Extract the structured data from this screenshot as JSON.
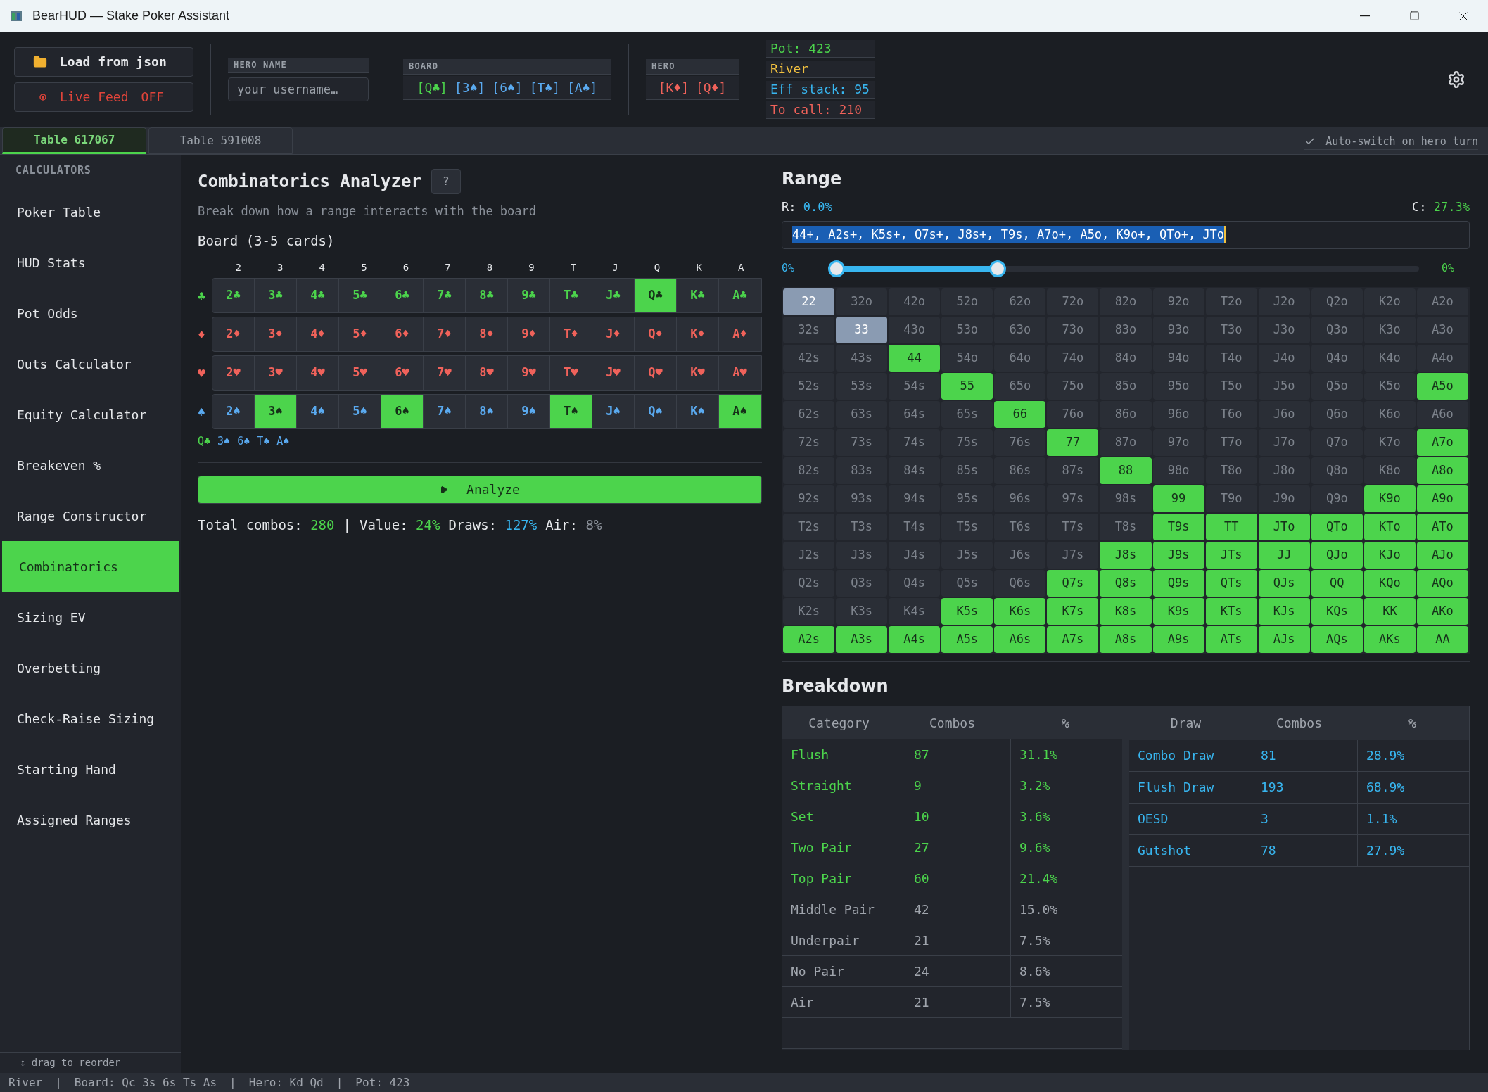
{
  "window": {
    "title": "BearHUD — Stake Poker Assistant"
  },
  "toolbar": {
    "load_button": "Load from json",
    "live_feed": {
      "label": "Live Feed",
      "state": "OFF",
      "on": false
    },
    "hero_name": {
      "label": "HERO NAME",
      "placeholder": "your username…"
    },
    "board": {
      "label": "BOARD",
      "cards": [
        {
          "label": "[Q♣]",
          "color": "#4cd44c"
        },
        {
          "label": "[3♠]",
          "color": "#5aaaf0"
        },
        {
          "label": "[6♠]",
          "color": "#5aaaf0"
        },
        {
          "label": "[T♠]",
          "color": "#5aaaf0"
        },
        {
          "label": "[A♠]",
          "color": "#5aaaf0"
        }
      ]
    },
    "hero": {
      "label": "HERO",
      "cards": [
        {
          "label": "[K♦]",
          "color": "#f0625a"
        },
        {
          "label": "[Q♦]",
          "color": "#f0625a"
        }
      ]
    },
    "stats": [
      {
        "label": "Pot: 423",
        "color": "#4cd44c"
      },
      {
        "label": "River",
        "color": "#f0c040"
      },
      {
        "label": "Eff stack: 95",
        "color": "#38b6f0"
      },
      {
        "label": "To call: 210",
        "color": "#f0625a"
      }
    ]
  },
  "tabs": [
    {
      "label": "Table 617067",
      "selected": true
    },
    {
      "label": "Table 591008",
      "selected": false
    }
  ],
  "auto_switch": {
    "label": "Auto-switch on hero turn",
    "checked": true
  },
  "sidebar": {
    "heading": "CALCULATORS",
    "items": [
      {
        "label": "Poker Table",
        "selected": false
      },
      {
        "label": "HUD Stats",
        "selected": false
      },
      {
        "label": "Pot Odds",
        "selected": false
      },
      {
        "label": "Outs Calculator",
        "selected": false
      },
      {
        "label": "Equity Calculator",
        "selected": false
      },
      {
        "label": "Breakeven %",
        "selected": false
      },
      {
        "label": "Range Constructor",
        "selected": false
      },
      {
        "label": "Combinatorics",
        "selected": true
      },
      {
        "label": "Sizing EV",
        "selected": false
      },
      {
        "label": "Overbetting",
        "selected": false
      },
      {
        "label": "Check-Raise Sizing",
        "selected": false
      },
      {
        "label": "Starting Hand",
        "selected": false
      },
      {
        "label": "Assigned Ranges",
        "selected": false
      }
    ],
    "footer": "↕ drag to reorder"
  },
  "analyzer": {
    "title": "Combinatorics Analyzer",
    "help": "?",
    "subtitle": "Break down how a range interacts with the board",
    "board_label": "Board (3-5 cards)",
    "ranks": [
      "2",
      "3",
      "4",
      "5",
      "6",
      "7",
      "8",
      "9",
      "T",
      "J",
      "Q",
      "K",
      "A"
    ],
    "suits": [
      {
        "symbol": "♣",
        "color": "#4cd44c",
        "cards": [
          {
            "label": "2♣",
            "selected": false
          },
          {
            "label": "3♣",
            "selected": false
          },
          {
            "label": "4♣",
            "selected": false
          },
          {
            "label": "5♣",
            "selected": false
          },
          {
            "label": "6♣",
            "selected": false
          },
          {
            "label": "7♣",
            "selected": false
          },
          {
            "label": "8♣",
            "selected": false
          },
          {
            "label": "9♣",
            "selected": false
          },
          {
            "label": "T♣",
            "selected": false
          },
          {
            "label": "J♣",
            "selected": false
          },
          {
            "label": "Q♣",
            "selected": true
          },
          {
            "label": "K♣",
            "selected": false
          },
          {
            "label": "A♣",
            "selected": false
          }
        ]
      },
      {
        "symbol": "♦",
        "color": "#f0625a",
        "cards": [
          {
            "label": "2♦",
            "selected": false
          },
          {
            "label": "3♦",
            "selected": false
          },
          {
            "label": "4♦",
            "selected": false
          },
          {
            "label": "5♦",
            "selected": false
          },
          {
            "label": "6♦",
            "selected": false
          },
          {
            "label": "7♦",
            "selected": false
          },
          {
            "label": "8♦",
            "selected": false
          },
          {
            "label": "9♦",
            "selected": false
          },
          {
            "label": "T♦",
            "selected": false
          },
          {
            "label": "J♦",
            "selected": false
          },
          {
            "label": "Q♦",
            "selected": false
          },
          {
            "label": "K♦",
            "selected": false
          },
          {
            "label": "A♦",
            "selected": false
          }
        ]
      },
      {
        "symbol": "♥",
        "color": "#f0625b",
        "cards": [
          {
            "label": "2♥",
            "selected": false
          },
          {
            "label": "3♥",
            "selected": false
          },
          {
            "label": "4♥",
            "selected": false
          },
          {
            "label": "5♥",
            "selected": false
          },
          {
            "label": "6♥",
            "selected": false
          },
          {
            "label": "7♥",
            "selected": false
          },
          {
            "label": "8♥",
            "selected": false
          },
          {
            "label": "9♥",
            "selected": false
          },
          {
            "label": "T♥",
            "selected": false
          },
          {
            "label": "J♥",
            "selected": false
          },
          {
            "label": "Q♥",
            "selected": false
          },
          {
            "label": "K♥",
            "selected": false
          },
          {
            "label": "A♥",
            "selected": false
          }
        ]
      },
      {
        "symbol": "♠",
        "color": "#5aaaf0",
        "cards": [
          {
            "label": "2♠",
            "selected": false
          },
          {
            "label": "3♠",
            "selected": true
          },
          {
            "label": "4♠",
            "selected": false
          },
          {
            "label": "5♠",
            "selected": false
          },
          {
            "label": "6♠",
            "selected": true
          },
          {
            "label": "7♠",
            "selected": false
          },
          {
            "label": "8♠",
            "selected": false
          },
          {
            "label": "9♠",
            "selected": false
          },
          {
            "label": "T♠",
            "selected": true
          },
          {
            "label": "J♠",
            "selected": false
          },
          {
            "label": "Q♠",
            "selected": false
          },
          {
            "label": "K♠",
            "selected": false
          },
          {
            "label": "A♠",
            "selected": true
          }
        ]
      }
    ],
    "picked": [
      {
        "label": "Q♣",
        "color": "#4cd44c"
      },
      {
        "label": "3♠",
        "color": "#5aaaf0"
      },
      {
        "label": "6♠",
        "color": "#5aaaf0"
      },
      {
        "label": "T♠",
        "color": "#5aaaf0"
      },
      {
        "label": "A♠",
        "color": "#5aaaf0"
      }
    ],
    "analyze_button": "Analyze",
    "summary": [
      {
        "kind": "stat",
        "label": "Total combos:",
        "value": "280",
        "color": "#4cd44c"
      },
      {
        "kind": "separator",
        "label": "|"
      },
      {
        "kind": "stat",
        "label": "Value:",
        "value": "24%",
        "color": "#4cd44d"
      },
      {
        "kind": "stat",
        "label": "Draws:",
        "value": "127%",
        "color": "#38b6f0"
      },
      {
        "kind": "stat",
        "label": "Air:",
        "value": "8%",
        "color": "#8a9099"
      }
    ]
  },
  "range": {
    "title": "Range",
    "r_label": "R:",
    "r_value": "0.0%",
    "c_label": "C:",
    "c_value": "27.3%",
    "value": "44+, A2s+, K5s+, Q7s+, J8s+, T9s, A7o+, A5o, K9o+, QTo+, JTo",
    "selected": true,
    "slider": {
      "min_label": "0%",
      "max_label": "0%",
      "thumbs": [
        {
          "level": 0
        },
        {
          "level": 0.276
        }
      ]
    },
    "rows": [
      {
        "cells": [
          {
            "label": "22",
            "selected": false,
            "marked": true
          },
          {
            "label": "32o",
            "selected": false,
            "marked": false
          },
          {
            "label": "42o",
            "selected": false,
            "marked": false
          },
          {
            "label": "52o",
            "selected": false,
            "marked": false
          },
          {
            "label": "62o",
            "selected": false,
            "marked": false
          },
          {
            "label": "72o",
            "selected": false,
            "marked": false
          },
          {
            "label": "82o",
            "selected": false,
            "marked": false
          },
          {
            "label": "92o",
            "selected": false,
            "marked": false
          },
          {
            "label": "T2o",
            "selected": false,
            "marked": false
          },
          {
            "label": "J2o",
            "selected": false,
            "marked": false
          },
          {
            "label": "Q2o",
            "selected": false,
            "marked": false
          },
          {
            "label": "K2o",
            "selected": false,
            "marked": false
          },
          {
            "label": "A2o",
            "selected": false,
            "marked": false
          }
        ]
      },
      {
        "cells": [
          {
            "label": "32s",
            "selected": false,
            "marked": false
          },
          {
            "label": "33",
            "selected": false,
            "marked": true
          },
          {
            "label": "43o",
            "selected": false,
            "marked": false
          },
          {
            "label": "53o",
            "selected": false,
            "marked": false
          },
          {
            "label": "63o",
            "selected": false,
            "marked": false
          },
          {
            "label": "73o",
            "selected": false,
            "marked": false
          },
          {
            "label": "83o",
            "selected": false,
            "marked": false
          },
          {
            "label": "93o",
            "selected": false,
            "marked": false
          },
          {
            "label": "T3o",
            "selected": false,
            "marked": false
          },
          {
            "label": "J3o",
            "selected": false,
            "marked": false
          },
          {
            "label": "Q3o",
            "selected": false,
            "marked": false
          },
          {
            "label": "K3o",
            "selected": false,
            "marked": false
          },
          {
            "label": "A3o",
            "selected": false,
            "marked": false
          }
        ]
      },
      {
        "cells": [
          {
            "label": "42s",
            "selected": false,
            "marked": false
          },
          {
            "label": "43s",
            "selected": false,
            "marked": false
          },
          {
            "label": "44",
            "selected": true,
            "marked": false
          },
          {
            "label": "54o",
            "selected": false,
            "marked": false
          },
          {
            "label": "64o",
            "selected": false,
            "marked": false
          },
          {
            "label": "74o",
            "selected": false,
            "marked": false
          },
          {
            "label": "84o",
            "selected": false,
            "marked": false
          },
          {
            "label": "94o",
            "selected": false,
            "marked": false
          },
          {
            "label": "T4o",
            "selected": false,
            "marked": false
          },
          {
            "label": "J4o",
            "selected": false,
            "marked": false
          },
          {
            "label": "Q4o",
            "selected": false,
            "marked": false
          },
          {
            "label": "K4o",
            "selected": false,
            "marked": false
          },
          {
            "label": "A4o",
            "selected": false,
            "marked": false
          }
        ]
      },
      {
        "cells": [
          {
            "label": "52s",
            "selected": false,
            "marked": false
          },
          {
            "label": "53s",
            "selected": false,
            "marked": false
          },
          {
            "label": "54s",
            "selected": false,
            "marked": false
          },
          {
            "label": "55",
            "selected": true,
            "marked": false
          },
          {
            "label": "65o",
            "selected": false,
            "marked": false
          },
          {
            "label": "75o",
            "selected": false,
            "marked": false
          },
          {
            "label": "85o",
            "selected": false,
            "marked": false
          },
          {
            "label": "95o",
            "selected": false,
            "marked": false
          },
          {
            "label": "T5o",
            "selected": false,
            "marked": false
          },
          {
            "label": "J5o",
            "selected": false,
            "marked": false
          },
          {
            "label": "Q5o",
            "selected": false,
            "marked": false
          },
          {
            "label": "K5o",
            "selected": false,
            "marked": false
          },
          {
            "label": "A5o",
            "selected": true,
            "marked": false
          }
        ]
      },
      {
        "cells": [
          {
            "label": "62s",
            "selected": false,
            "marked": false
          },
          {
            "label": "63s",
            "selected": false,
            "marked": false
          },
          {
            "label": "64s",
            "selected": false,
            "marked": false
          },
          {
            "label": "65s",
            "selected": false,
            "marked": false
          },
          {
            "label": "66",
            "selected": true,
            "marked": false
          },
          {
            "label": "76o",
            "selected": false,
            "marked": false
          },
          {
            "label": "86o",
            "selected": false,
            "marked": false
          },
          {
            "label": "96o",
            "selected": false,
            "marked": false
          },
          {
            "label": "T6o",
            "selected": false,
            "marked": false
          },
          {
            "label": "J6o",
            "selected": false,
            "marked": false
          },
          {
            "label": "Q6o",
            "selected": false,
            "marked": false
          },
          {
            "label": "K6o",
            "selected": false,
            "marked": false
          },
          {
            "label": "A6o",
            "selected": false,
            "marked": false
          }
        ]
      },
      {
        "cells": [
          {
            "label": "72s",
            "selected": false,
            "marked": false
          },
          {
            "label": "73s",
            "selected": false,
            "marked": false
          },
          {
            "label": "74s",
            "selected": false,
            "marked": false
          },
          {
            "label": "75s",
            "selected": false,
            "marked": false
          },
          {
            "label": "76s",
            "selected": false,
            "marked": false
          },
          {
            "label": "77",
            "selected": true,
            "marked": false
          },
          {
            "label": "87o",
            "selected": false,
            "marked": false
          },
          {
            "label": "97o",
            "selected": false,
            "marked": false
          },
          {
            "label": "T7o",
            "selected": false,
            "marked": false
          },
          {
            "label": "J7o",
            "selected": false,
            "marked": false
          },
          {
            "label": "Q7o",
            "selected": false,
            "marked": false
          },
          {
            "label": "K7o",
            "selected": false,
            "marked": false
          },
          {
            "label": "A7o",
            "selected": true,
            "marked": false
          }
        ]
      },
      {
        "cells": [
          {
            "label": "82s",
            "selected": false,
            "marked": false
          },
          {
            "label": "83s",
            "selected": false,
            "marked": false
          },
          {
            "label": "84s",
            "selected": false,
            "marked": false
          },
          {
            "label": "85s",
            "selected": false,
            "marked": false
          },
          {
            "label": "86s",
            "selected": false,
            "marked": false
          },
          {
            "label": "87s",
            "selected": false,
            "marked": false
          },
          {
            "label": "88",
            "selected": true,
            "marked": false
          },
          {
            "label": "98o",
            "selected": false,
            "marked": false
          },
          {
            "label": "T8o",
            "selected": false,
            "marked": false
          },
          {
            "label": "J8o",
            "selected": false,
            "marked": false
          },
          {
            "label": "Q8o",
            "selected": false,
            "marked": false
          },
          {
            "label": "K8o",
            "selected": false,
            "marked": false
          },
          {
            "label": "A8o",
            "selected": true,
            "marked": false
          }
        ]
      },
      {
        "cells": [
          {
            "label": "92s",
            "selected": false,
            "marked": false
          },
          {
            "label": "93s",
            "selected": false,
            "marked": false
          },
          {
            "label": "94s",
            "selected": false,
            "marked": false
          },
          {
            "label": "95s",
            "selected": false,
            "marked": false
          },
          {
            "label": "96s",
            "selected": false,
            "marked": false
          },
          {
            "label": "97s",
            "selected": false,
            "marked": false
          },
          {
            "label": "98s",
            "selected": false,
            "marked": false
          },
          {
            "label": "99",
            "selected": true,
            "marked": false
          },
          {
            "label": "T9o",
            "selected": false,
            "marked": false
          },
          {
            "label": "J9o",
            "selected": false,
            "marked": false
          },
          {
            "label": "Q9o",
            "selected": false,
            "marked": false
          },
          {
            "label": "K9o",
            "selected": true,
            "marked": false
          },
          {
            "label": "A9o",
            "selected": true,
            "marked": false
          }
        ]
      },
      {
        "cells": [
          {
            "label": "T2s",
            "selected": false,
            "marked": false
          },
          {
            "label": "T3s",
            "selected": false,
            "marked": false
          },
          {
            "label": "T4s",
            "selected": false,
            "marked": false
          },
          {
            "label": "T5s",
            "selected": false,
            "marked": false
          },
          {
            "label": "T6s",
            "selected": false,
            "marked": false
          },
          {
            "label": "T7s",
            "selected": false,
            "marked": false
          },
          {
            "label": "T8s",
            "selected": false,
            "marked": false
          },
          {
            "label": "T9s",
            "selected": true,
            "marked": false
          },
          {
            "label": "TT",
            "selected": true,
            "marked": false
          },
          {
            "label": "JTo",
            "selected": true,
            "marked": false
          },
          {
            "label": "QTo",
            "selected": true,
            "marked": false
          },
          {
            "label": "KTo",
            "selected": true,
            "marked": false
          },
          {
            "label": "ATo",
            "selected": true,
            "marked": false
          }
        ]
      },
      {
        "cells": [
          {
            "label": "J2s",
            "selected": false,
            "marked": false
          },
          {
            "label": "J3s",
            "selected": false,
            "marked": false
          },
          {
            "label": "J4s",
            "selected": false,
            "marked": false
          },
          {
            "label": "J5s",
            "selected": false,
            "marked": false
          },
          {
            "label": "J6s",
            "selected": false,
            "marked": false
          },
          {
            "label": "J7s",
            "selected": false,
            "marked": false
          },
          {
            "label": "J8s",
            "selected": true,
            "marked": false
          },
          {
            "label": "J9s",
            "selected": true,
            "marked": false
          },
          {
            "label": "JTs",
            "selected": true,
            "marked": false
          },
          {
            "label": "JJ",
            "selected": true,
            "marked": false
          },
          {
            "label": "QJo",
            "selected": true,
            "marked": false
          },
          {
            "label": "KJo",
            "selected": true,
            "marked": false
          },
          {
            "label": "AJo",
            "selected": true,
            "marked": false
          }
        ]
      },
      {
        "cells": [
          {
            "label": "Q2s",
            "selected": false,
            "marked": false
          },
          {
            "label": "Q3s",
            "selected": false,
            "marked": false
          },
          {
            "label": "Q4s",
            "selected": false,
            "marked": false
          },
          {
            "label": "Q5s",
            "selected": false,
            "marked": false
          },
          {
            "label": "Q6s",
            "selected": false,
            "marked": false
          },
          {
            "label": "Q7s",
            "selected": true,
            "marked": false
          },
          {
            "label": "Q8s",
            "selected": true,
            "marked": false
          },
          {
            "label": "Q9s",
            "selected": true,
            "marked": false
          },
          {
            "label": "QTs",
            "selected": true,
            "marked": false
          },
          {
            "label": "QJs",
            "selected": true,
            "marked": false
          },
          {
            "label": "QQ",
            "selected": true,
            "marked": false
          },
          {
            "label": "KQo",
            "selected": true,
            "marked": false
          },
          {
            "label": "AQo",
            "selected": true,
            "marked": false
          }
        ]
      },
      {
        "cells": [
          {
            "label": "K2s",
            "selected": false,
            "marked": false
          },
          {
            "label": "K3s",
            "selected": false,
            "marked": false
          },
          {
            "label": "K4s",
            "selected": false,
            "marked": false
          },
          {
            "label": "K5s",
            "selected": true,
            "marked": false
          },
          {
            "label": "K6s",
            "selected": true,
            "marked": false
          },
          {
            "label": "K7s",
            "selected": true,
            "marked": false
          },
          {
            "label": "K8s",
            "selected": true,
            "marked": false
          },
          {
            "label": "K9s",
            "selected": true,
            "marked": false
          },
          {
            "label": "KTs",
            "selected": true,
            "marked": false
          },
          {
            "label": "KJs",
            "selected": true,
            "marked": false
          },
          {
            "label": "KQs",
            "selected": true,
            "marked": false
          },
          {
            "label": "KK",
            "selected": true,
            "marked": false
          },
          {
            "label": "AKo",
            "selected": true,
            "marked": false
          }
        ]
      },
      {
        "cells": [
          {
            "label": "A2s",
            "selected": true,
            "marked": false
          },
          {
            "label": "A3s",
            "selected": true,
            "marked": false
          },
          {
            "label": "A4s",
            "selected": true,
            "marked": false
          },
          {
            "label": "A5s",
            "selected": true,
            "marked": false
          },
          {
            "label": "A6s",
            "selected": true,
            "marked": false
          },
          {
            "label": "A7s",
            "selected": true,
            "marked": false
          },
          {
            "label": "A8s",
            "selected": true,
            "marked": false
          },
          {
            "label": "A9s",
            "selected": true,
            "marked": false
          },
          {
            "label": "ATs",
            "selected": true,
            "marked": false
          },
          {
            "label": "AJs",
            "selected": true,
            "marked": false
          },
          {
            "label": "AQs",
            "selected": true,
            "marked": false
          },
          {
            "label": "AKs",
            "selected": true,
            "marked": false
          },
          {
            "label": "AA",
            "selected": true,
            "marked": false
          }
        ]
      }
    ]
  },
  "breakdown": {
    "title": "Breakdown",
    "categories": {
      "columns": [
        "Category",
        "Combos",
        "%"
      ],
      "rows": [
        {
          "name": "Flush",
          "combos": "87",
          "percent": "31.1%",
          "color": "#4cd44c"
        },
        {
          "name": "Straight",
          "combos": "9",
          "percent": "3.2%",
          "color": "#4cd44c"
        },
        {
          "name": "Set",
          "combos": "10",
          "percent": "3.6%",
          "color": "#4cd44c"
        },
        {
          "name": "Two Pair",
          "combos": "27",
          "percent": "9.6%",
          "color": "#4cd44c"
        },
        {
          "name": "Top Pair",
          "combos": "60",
          "percent": "21.4%",
          "color": "#4cd44c"
        },
        {
          "name": "Middle Pair",
          "combos": "42",
          "percent": "15.0%",
          "color": "#a0a5ad"
        },
        {
          "name": "Underpair",
          "combos": "21",
          "percent": "7.5%",
          "color": "#a0a5ad"
        },
        {
          "name": "No Pair",
          "combos": "24",
          "percent": "8.6%",
          "color": "#a0a5ad"
        },
        {
          "name": "Air",
          "combos": "21",
          "percent": "7.5%",
          "color": "#a0a5ad"
        }
      ]
    },
    "draws": {
      "columns": [
        "Draw",
        "Combos",
        "%"
      ],
      "rows": [
        {
          "name": "Combo Draw",
          "combos": "81",
          "percent": "28.9%",
          "color": "#38b6f0"
        },
        {
          "name": "Flush Draw",
          "combos": "193",
          "percent": "68.9%",
          "color": "#38b6f0"
        },
        {
          "name": "OESD",
          "combos": "3",
          "percent": "1.1%",
          "color": "#38b6f0"
        },
        {
          "name": "Gutshot",
          "combos": "78",
          "percent": "27.9%",
          "color": "#38b6f0"
        }
      ]
    }
  },
  "status_bar": [
    "River",
    "|",
    "Board: Qc 3s 6s Ts As",
    "|",
    "Hero: Kd Qd",
    "|",
    "Pot: 423"
  ]
}
